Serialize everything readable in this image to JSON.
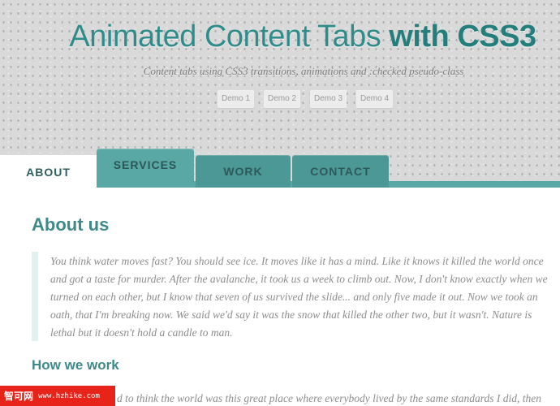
{
  "header": {
    "title_light": "Animated Content Tabs",
    "title_strong": "with CSS3",
    "subtitle": "Content tabs using CSS3 transitions, animations and :checked pseudo-class",
    "demos": [
      "Demo 1",
      "Demo 2",
      "Demo 3",
      "Demo 4"
    ]
  },
  "tabs": [
    {
      "label": "ABOUT",
      "active": true
    },
    {
      "label": "SERVICES",
      "active": false
    },
    {
      "label": "WORK",
      "active": false
    },
    {
      "label": "CONTACT",
      "active": false
    }
  ],
  "content": {
    "heading": "About us",
    "quote_lines": [
      "You think water moves fast? You should see ice. It moves like it has a mind. Like it knows it killed the world once",
      "and got a taste for murder. After the avalanche, it took us a week to climb out. Now, I don't know exactly when we",
      "turned on each other, but I know that seven of us survived the slide... and only five made it out. Now we took an",
      "oath, that I'm breaking now. We said we'd say it was the snow that killed the other two, but it wasn't. Nature is",
      "lethal but it doesn't hold a candle to man."
    ],
    "subheading": "How we work",
    "paragraph_fragment": "d to think the world was this great place where everybody lived by the same standards I did, then"
  },
  "watermark": {
    "chinese": "智可网",
    "url": "www.hzhike.com"
  },
  "colors": {
    "teal": "#5aa8a5",
    "teal_dark": "#4c9896",
    "heading": "#3f8a88",
    "title": "#2f8c8a"
  }
}
